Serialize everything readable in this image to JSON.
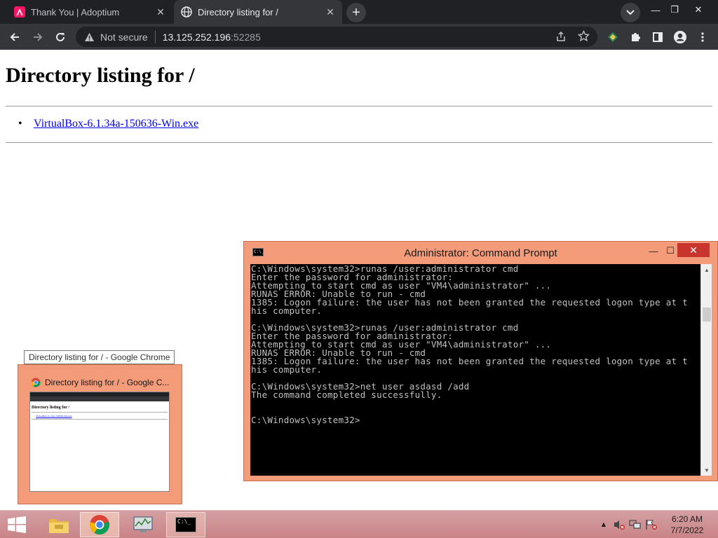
{
  "browser": {
    "tabs": [
      {
        "title": "Thank You | Adoptium",
        "active": false
      },
      {
        "title": "Directory listing for /",
        "active": true
      }
    ],
    "security_label": "Not secure",
    "url_host": "13.125.252.196",
    "url_port": ":52285"
  },
  "page": {
    "heading": "Directory listing for /",
    "files": [
      "VirtualBox-6.1.34a-150636-Win.exe"
    ]
  },
  "cmd": {
    "title": "Administrator: Command Prompt",
    "icon_text": "C:\\_",
    "output": "C:\\Windows\\system32>runas /user:administrator cmd\nEnter the password for administrator:\nAttempting to start cmd as user \"VM4\\administrator\" ...\nRUNAS ERROR: Unable to run - cmd\n1385: Logon failure: the user has not been granted the requested logon type at t\nhis computer.\n\nC:\\Windows\\system32>runas /user:administrator cmd\nEnter the password for administrator:\nAttempting to start cmd as user \"VM4\\administrator\" ...\nRUNAS ERROR: Unable to run - cmd\n1385: Logon failure: the user has not been granted the requested logon type at t\nhis computer.\n\nC:\\Windows\\system32>net user asdasd /add\nThe command completed successfully.\n\n\nC:\\Windows\\system32>"
  },
  "preview": {
    "tooltip": "Directory listing for / - Google Chrome",
    "title": "Directory listing for / - Google C...",
    "thumb_heading": "Directory listing for /",
    "thumb_link": "VirtualBox-6.1.34a-150636-Win.exe"
  },
  "taskbar": {
    "cmd_icon_text": "C:\\_",
    "time": "6:20 AM",
    "date": "7/7/2022"
  },
  "colors": {
    "window_frame": "#f49b7a",
    "taskbar": "#c98487",
    "chrome_dark": "#202124",
    "link": "#0000ee"
  }
}
